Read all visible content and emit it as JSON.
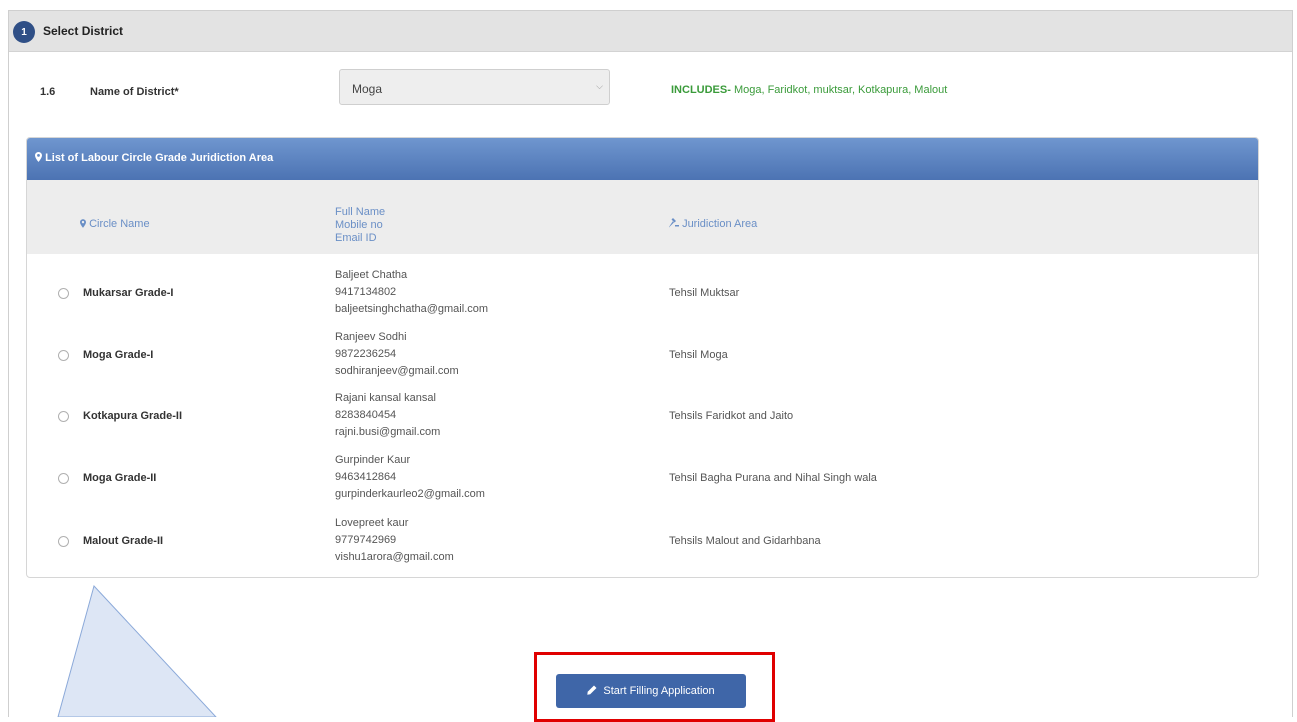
{
  "step": {
    "number": "1",
    "title": "Select District"
  },
  "district_field": {
    "number": "1.6",
    "label": "Name of District*",
    "selected_value": "Moga",
    "includes_prefix": "INCLUDES-",
    "includes_text": "Moga, Faridkot, muktsar, Kotkapura, Malout"
  },
  "list": {
    "title": "List of Labour Circle Grade Juridiction Area",
    "columns": {
      "circle_name": "Circle Name",
      "contact_line1": "Full Name",
      "contact_line2": "Mobile no",
      "contact_line3": "Email ID",
      "area": "Juridiction Area"
    },
    "rows": [
      {
        "circle": "Mukarsar Grade-I",
        "name": "Baljeet Chatha",
        "mobile": "9417134802",
        "email": "baljeetsinghchatha@gmail.com",
        "area": "Tehsil Muktsar"
      },
      {
        "circle": "Moga Grade-I",
        "name": "Ranjeev Sodhi",
        "mobile": "9872236254",
        "email": "sodhiranjeev@gmail.com",
        "area": "Tehsil Moga"
      },
      {
        "circle": "Kotkapura Grade-II",
        "name": "Rajani kansal kansal",
        "mobile": "8283840454",
        "email": "rajni.busi@gmail.com",
        "area": "Tehsils Faridkot and Jaito"
      },
      {
        "circle": "Moga Grade-II",
        "name": "Gurpinder Kaur",
        "mobile": "9463412864",
        "email": "gurpinderkaurleo2@gmail.com",
        "area": "Tehsil Bagha Purana and Nihal Singh wala"
      },
      {
        "circle": "Malout Grade-II",
        "name": "Lovepreet kaur",
        "mobile": "9779742969",
        "email": "vishu1arora@gmail.com",
        "area": "Tehsils Malout and Gidarhbana"
      }
    ]
  },
  "action": {
    "start_label": "Start Filling Application"
  },
  "colors": {
    "header_blue": "#4c73b3",
    "button_blue": "#3f66a8",
    "includes_green": "#3a9b3a",
    "highlight_red": "#e00000"
  },
  "icons": {
    "header": "map-marker-icon",
    "circle_col": "map-marker-icon",
    "area_col": "gavel-icon",
    "button": "pencil-icon",
    "select": "chevron-down-icon"
  }
}
